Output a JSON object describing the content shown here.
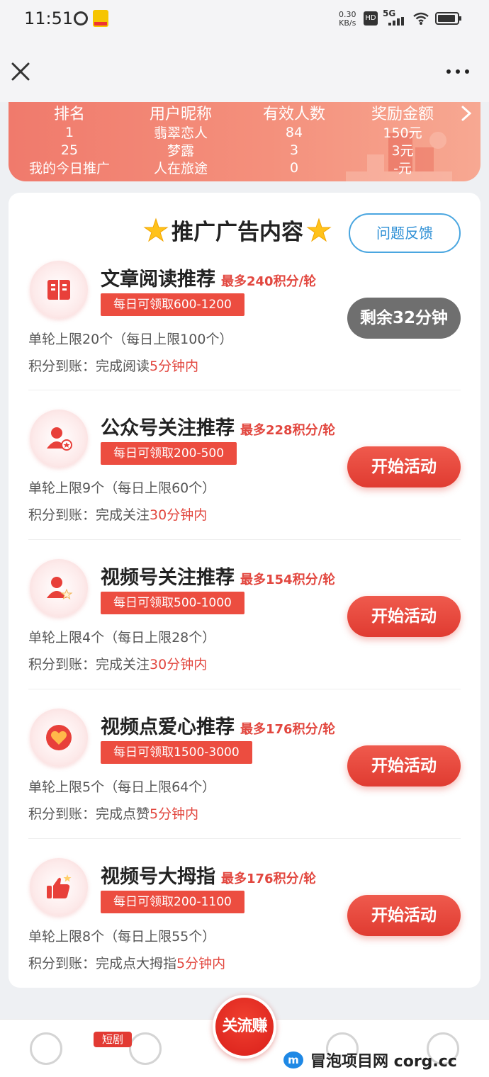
{
  "status_bar": {
    "time": "11:51",
    "net_speed_value": "0.30",
    "net_speed_unit": "KB/s",
    "hd": "HD",
    "network": "5G",
    "battery_level_percent": 80
  },
  "banner": {
    "headers": [
      "排名",
      "用户昵称",
      "有效人数",
      "奖励金额"
    ],
    "rows": [
      [
        "1",
        "翡翠恋人",
        "84",
        "150元"
      ],
      [
        "25",
        "梦露",
        "3",
        "3元"
      ],
      [
        "我的今日推广",
        "人在旅途",
        "0",
        "-元"
      ]
    ]
  },
  "card": {
    "title": "推广广告内容",
    "feedback_label": "问题反馈",
    "tasks": [
      {
        "icon": "book-icon",
        "name": "文章阅读推荐",
        "max": "最多240积分/轮",
        "daily": "每日可领取600-1200",
        "limit": "单轮上限20个（每日上限100个）",
        "arrive_prefix": "积分到账：完成阅读",
        "arrive_hl": "5分钟内",
        "button": "剩余32分钟",
        "button_state": "disabled"
      },
      {
        "icon": "user-follow-icon",
        "name": "公众号关注推荐",
        "max": "最多228积分/轮",
        "daily": "每日可领取200-500",
        "limit": "单轮上限9个（每日上限60个）",
        "arrive_prefix": "积分到账：完成关注",
        "arrive_hl": "30分钟内",
        "button": "开始活动",
        "button_state": "active"
      },
      {
        "icon": "user-star-icon",
        "name": "视频号关注推荐",
        "max": "最多154积分/轮",
        "daily": "每日可领取500-1000",
        "limit": "单轮上限4个（每日上限28个）",
        "arrive_prefix": "积分到账：完成关注",
        "arrive_hl": "30分钟内",
        "button": "开始活动",
        "button_state": "active"
      },
      {
        "icon": "heart-icon",
        "name": "视频点爱心推荐",
        "max": "最多176积分/轮",
        "daily": "每日可领取1500-3000",
        "limit": "单轮上限5个（每日上限64个）",
        "arrive_prefix": "积分到账：完成点赞",
        "arrive_hl": "5分钟内",
        "button": "开始活动",
        "button_state": "active"
      },
      {
        "icon": "thumbs-up-icon",
        "name": "视频号大拇指",
        "max": "最多176积分/轮",
        "daily": "每日可领取200-1100",
        "limit": "单轮上限8个（每日上限55个）",
        "arrive_prefix": "积分到账：完成点大拇指",
        "arrive_hl": "5分钟内",
        "button": "开始活动",
        "button_state": "active"
      }
    ]
  },
  "bottom_nav": {
    "short_drama_tag": "短剧",
    "center_label": "关流赚"
  },
  "watermark": {
    "logo": "m",
    "text": "冒泡项目网  corg.cc"
  },
  "colors": {
    "accent_red": "#e2473f",
    "banner_start": "#f07a6c",
    "feedback_blue": "#2d8fd5",
    "disabled_gray": "#6f6f6f"
  }
}
